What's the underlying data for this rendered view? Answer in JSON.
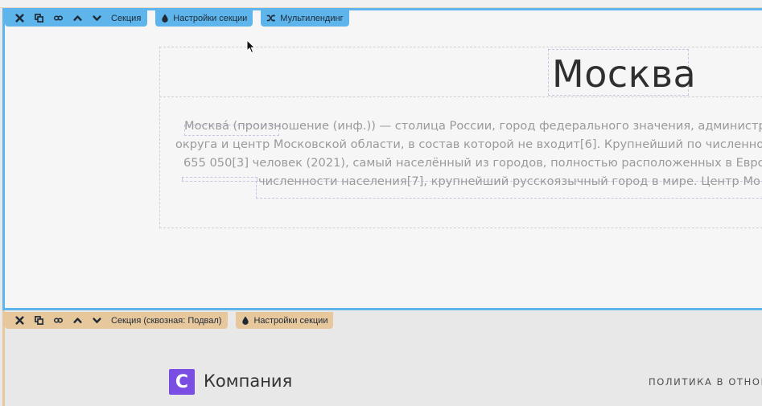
{
  "main_section": {
    "toolbar": {
      "delete_icon": "close-icon",
      "copy_icon": "copy-icon",
      "link_icon": "link-icon",
      "up_icon": "chevron-up-icon",
      "down_icon": "chevron-down-icon",
      "label": "Секция"
    },
    "settings_button": {
      "icon": "drop-icon",
      "label": "Настройки секции"
    },
    "multilanding_button": {
      "icon": "shuffle-icon",
      "label": "Мультилендинг"
    },
    "title": "Москва",
    "description_lines": [
      "Москва́ (произношение (инф.)) — столица России, город федерального значения, администр",
      "округа и центр Московской области, в состав которой не входит[6]. Крупнейший по численно",
      "655 050[3] человек (2021), самый населённый из городов, полностью расположенных в Евро",
      "численности населения[7], крупнейший русскоязычный город в мире. Центр Мо"
    ]
  },
  "footer_section": {
    "toolbar": {
      "label": "Секция (сквозная: Подвал)"
    },
    "settings_button": {
      "icon": "drop-icon",
      "label": "Настройки секции"
    },
    "logo_letter": "С",
    "company_name": "Компания",
    "policy_link": "ПОЛИТИКА В ОТНОШ"
  },
  "colors": {
    "active_accent": "#5db5ec",
    "footer_accent": "#e7c79c",
    "logo": "#7b4ee3"
  }
}
